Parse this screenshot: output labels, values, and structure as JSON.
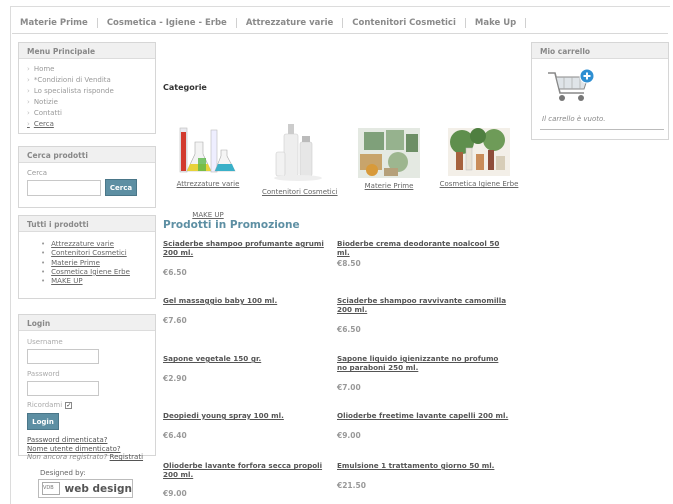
{
  "nav": {
    "items": [
      "Materie Prime",
      "Cosmetica - Igiene - Erbe",
      "Attrezzature varie",
      "Contenitori Cosmetici",
      "Make Up"
    ]
  },
  "menu": {
    "title": "Menu Principale",
    "items": [
      "Home",
      "*Condizioni di Vendita",
      "Lo specialista risponde",
      "Notizie",
      "Contatti",
      "Cerca"
    ]
  },
  "search": {
    "title": "Cerca prodotti",
    "label": "Cerca",
    "button": "Cerca"
  },
  "all_products": {
    "title": "Tutti i prodotti",
    "items": [
      "Attrezzature varie",
      "Contenitori Cosmetici",
      "Materie Prime",
      "Cosmetica Igiene Erbe",
      "MAKE UP"
    ]
  },
  "login": {
    "title": "Login",
    "username_label": "Username",
    "password_label": "Password",
    "remember_label": "Ricordami",
    "button": "Login",
    "forgot_password": "Password dimenticata?",
    "forgot_username": "Nome utente dimenticato?",
    "not_registered": "Non ancora registrato?",
    "register": "Registrati"
  },
  "designed_by": {
    "label": "Designed by:",
    "badge_alt": "VDB",
    "badge_text": "web design"
  },
  "categories": {
    "title": "Categorie",
    "items": [
      "Attrezzature varie",
      "Contenitori Cosmetici",
      "Materie Prime",
      "Cosmetica Igiene Erbe",
      "MAKE UP"
    ]
  },
  "promo": {
    "title": "Prodotti in Promozione",
    "products": [
      {
        "name": "Sciaderbe shampoo profumante agrumi 200 ml.",
        "price": "€6.50"
      },
      {
        "name": "Bioderbe crema deodorante noalcool 50 ml.",
        "price": "€8.50"
      },
      {
        "name": "Gel massaggio baby 100 ml.",
        "price": "€7.60"
      },
      {
        "name": "Sciaderbe shampoo ravvivante camomilla 200 ml.",
        "price": "€6.50"
      },
      {
        "name": "Sapone vegetale 150 gr.",
        "price": "€2.90"
      },
      {
        "name": "Sapone liquido igienizzante no profumo no paraboni 250 ml.",
        "price": "€7.00"
      },
      {
        "name": "Deopiedi young spray 100 ml.",
        "price": "€6.40"
      },
      {
        "name": "Olioderbe freetime lavante capelli 200 ml.",
        "price": "€9.00"
      },
      {
        "name": "Olioderbe lavante forfora secca propoli 200 ml.",
        "price": "€9.00"
      },
      {
        "name": "Emulsione 1 trattamento giorno 50 ml.",
        "price": "€21.50"
      }
    ]
  },
  "cart": {
    "title": "Mio carrello",
    "empty": "Il carrello è vuoto."
  }
}
